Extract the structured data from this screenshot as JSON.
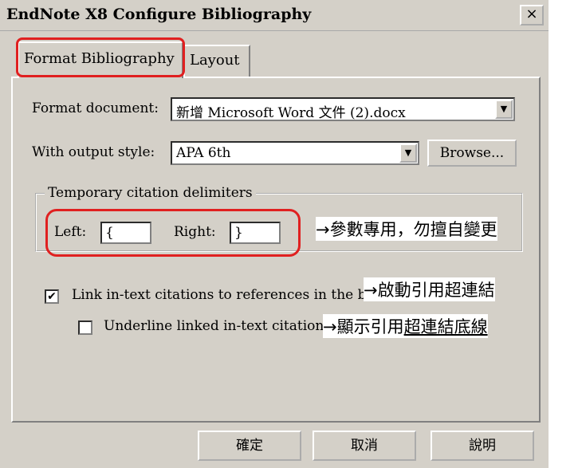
{
  "window": {
    "title": "EndNote X8 Configure Bibliography",
    "close_label": "×"
  },
  "tabs": [
    {
      "label": "Format Bibliography"
    },
    {
      "label": "Layout"
    }
  ],
  "format_document": {
    "label": "Format document:",
    "value": "新增 Microsoft Word 文件 (2).docx"
  },
  "output_style": {
    "label": "With output style:",
    "value": "APA 6th",
    "browse_label": "Browse..."
  },
  "delimiters": {
    "group_label": "Temporary citation delimiters",
    "left_label": "Left:",
    "left_value": "{",
    "right_label": "Right:",
    "right_value": "}"
  },
  "options": {
    "link_label": "Link in-text citations to references in the bil",
    "link_checked": true,
    "underline_label": "Underline linked in-text citations",
    "underline_checked": false
  },
  "buttons": {
    "ok": "確定",
    "cancel": "取消",
    "help": "說明"
  },
  "annotations": {
    "delimiters_note": "→參數專用，勿擅自變更",
    "link_note": "→啟動引用超連結",
    "underline_note_prefix": "→顯示引用",
    "underline_note_suffix": "超連結底線"
  },
  "colors": {
    "highlight": "#e02020",
    "dialog_bg": "#d4d0c8"
  }
}
